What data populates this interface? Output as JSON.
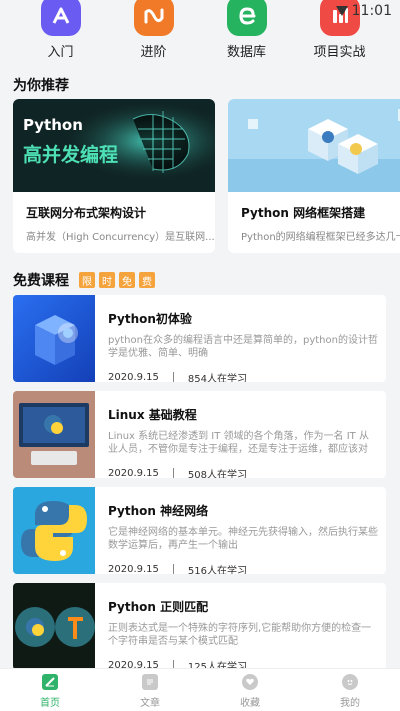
{
  "status": {
    "time": "11:01"
  },
  "categories": [
    {
      "label": "入门",
      "color": "#6a5cf2",
      "icon": "book-a-icon"
    },
    {
      "label": "进阶",
      "color": "#f07a28",
      "icon": "wave-icon"
    },
    {
      "label": "数据库",
      "color": "#26b35f",
      "icon": "database-icon"
    },
    {
      "label": "项目实战",
      "color": "#ef4a43",
      "icon": "chart-bars-icon"
    }
  ],
  "recommend": {
    "title": "为你推荐",
    "cards": [
      {
        "banner_line1": "Python",
        "banner_line2": "高并发编程",
        "title": "互联网分布式架构设计",
        "desc": "高并发（High Concurrency）是互联网..."
      },
      {
        "title": "Python 网络框架搭建",
        "desc": "Python的网络编程框架已经多达几十"
      }
    ]
  },
  "free": {
    "title": "免费课程",
    "tags": [
      "限",
      "时",
      "免",
      "费"
    ],
    "courses": [
      {
        "title": "Python初体验",
        "desc": "python在众多的编程语言中还是算简单的，python的设计哲学是优雅、简单、明确",
        "date": "2020.9.15",
        "learners": "854人在学习"
      },
      {
        "title": "Linux 基础教程",
        "desc": "Linux 系统已经渗透到 IT 领域的各个角落，作为一名 IT 从业人员，不管你是专注于编程，还是专注于运维，都应该对 Linux",
        "date": "2020.9.15",
        "learners": "508人在学习"
      },
      {
        "title": "Python 神经网络",
        "desc": "它是神经网络的基本单元。神经元先获得输入，然后执行某些数学运算后，再产生一个输出",
        "date": "2020.9.15",
        "learners": "516人在学习"
      },
      {
        "title": "Python 正则匹配",
        "desc": "正则表达式是一个特殊的字符序列,它能帮助你方便的检查一个字符串是否与某个模式匹配",
        "date": "2020.9.15",
        "learners": "125人在学习"
      }
    ]
  },
  "nav": [
    {
      "label": "首页",
      "active": true,
      "icon": "home-edit-icon"
    },
    {
      "label": "文章",
      "active": false,
      "icon": "article-icon"
    },
    {
      "label": "收藏",
      "active": false,
      "icon": "heart-icon"
    },
    {
      "label": "我的",
      "active": false,
      "icon": "profile-face-icon"
    }
  ],
  "colors": {
    "accent": "#2fb26a",
    "tag": "#f5a33c"
  }
}
